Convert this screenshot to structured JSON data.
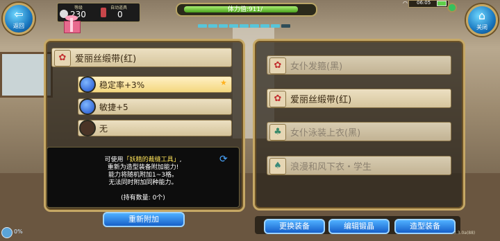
{
  "hud": {
    "level_label": "等级",
    "level_value": "230",
    "potion_label": "自动道具",
    "potion_value": "0",
    "stamina_text": "体力值:911/",
    "stamina_fraction": 0.91,
    "time": "06:05",
    "back_button": "返回",
    "close_button": "关闭"
  },
  "left": {
    "item_name": "爱丽丝缎带(红)",
    "attrs": [
      {
        "label": "稳定率+3%",
        "filled": true,
        "highlighted": true,
        "starred": true
      },
      {
        "label": "敏捷+5",
        "filled": true,
        "highlighted": false,
        "starred": false
      },
      {
        "label": "无",
        "filled": false,
        "highlighted": false,
        "starred": false
      }
    ],
    "desc_prefix": "可使用",
    "desc_highlight": "「妖精的裁缝工具」",
    "desc_suffix": ",",
    "desc_lines": [
      "重新为造型装备附加能力!",
      "能力将随机附加1~3格。",
      "无法同时附加同种能力。"
    ],
    "count_text": "(持有数量: 0个)",
    "reattach_button": "重新附加"
  },
  "right": {
    "items": [
      {
        "label": "女仆发箍(黑)",
        "dim": true,
        "icon": "ribbon-icon"
      },
      {
        "label": "爱丽丝缎带(红)",
        "dim": false,
        "icon": "ribbon-icon"
      },
      {
        "label": "女仆泳装上衣(黑)",
        "dim": true,
        "icon": "shirt-icon"
      },
      {
        "label": "浪漫和风下衣・学生",
        "dim": true,
        "icon": "skirt-icon"
      }
    ],
    "buttons": {
      "swap": "更换装备",
      "edit": "编辑锻晶",
      "style": "造型装备"
    }
  },
  "footer": {
    "percent": "0%",
    "version": "3.3.0a(88)"
  }
}
